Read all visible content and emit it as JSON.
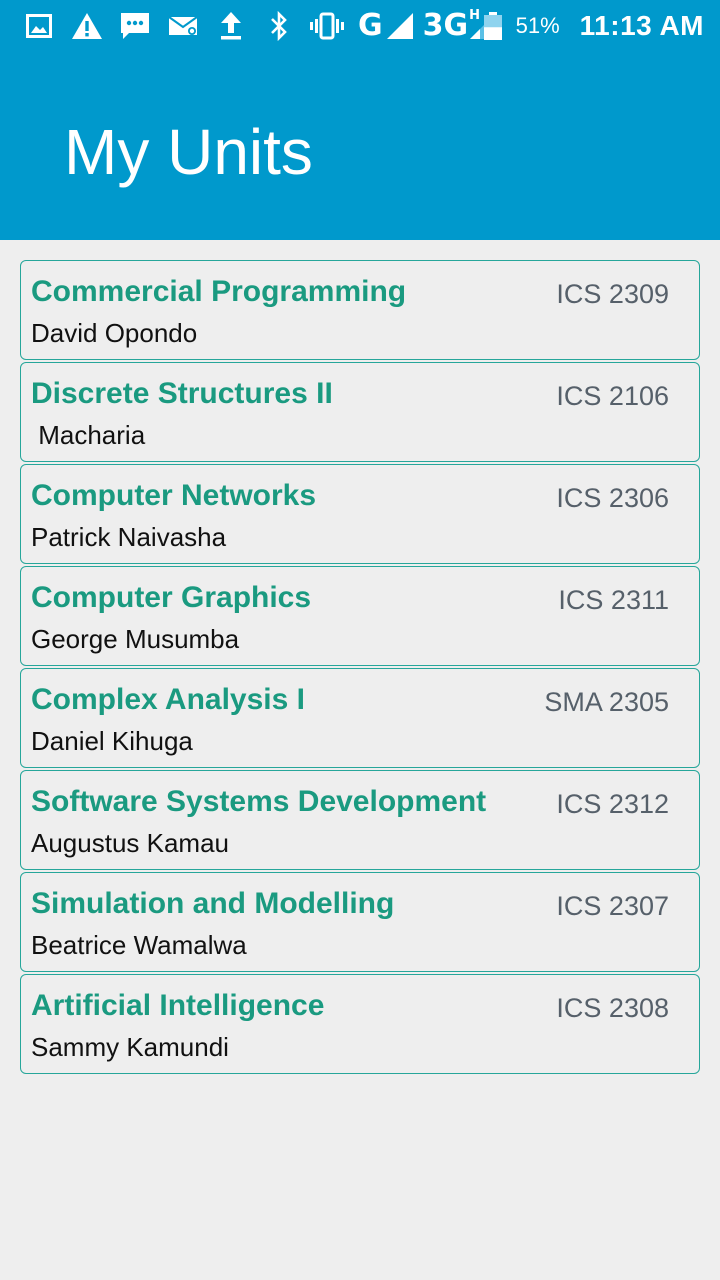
{
  "status_bar": {
    "icons": [
      "image-icon",
      "warning-icon",
      "message-icon",
      "mail-icon",
      "upload-icon",
      "bluetooth-icon",
      "vibrate-icon"
    ],
    "network_g": "G",
    "network_3g": "3G",
    "network_3g_sup": "H",
    "battery_percent": "51%",
    "battery_level": 0.51,
    "time": "11:13 AM"
  },
  "header": {
    "title": "My Units"
  },
  "colors": {
    "primary": "#0099cc",
    "accent": "#1a9a80",
    "background": "#eeeeee"
  },
  "units": [
    {
      "name": "Commercial Programming",
      "code": "ICS 2309",
      "lecturer": "David Opondo"
    },
    {
      "name": "Discrete Structures II",
      "code": "ICS 2106",
      "lecturer": " Macharia"
    },
    {
      "name": "Computer Networks",
      "code": "ICS 2306",
      "lecturer": "Patrick Naivasha"
    },
    {
      "name": "Computer Graphics",
      "code": "ICS 2311",
      "lecturer": "George Musumba"
    },
    {
      "name": "Complex Analysis I",
      "code": "SMA 2305",
      "lecturer": "Daniel Kihuga"
    },
    {
      "name": "Software Systems Development",
      "code": "ICS 2312",
      "lecturer": "Augustus Kamau"
    },
    {
      "name": "Simulation and Modelling",
      "code": "ICS 2307",
      "lecturer": "Beatrice Wamalwa"
    },
    {
      "name": "Artificial Intelligence",
      "code": "ICS 2308",
      "lecturer": "Sammy Kamundi"
    }
  ]
}
